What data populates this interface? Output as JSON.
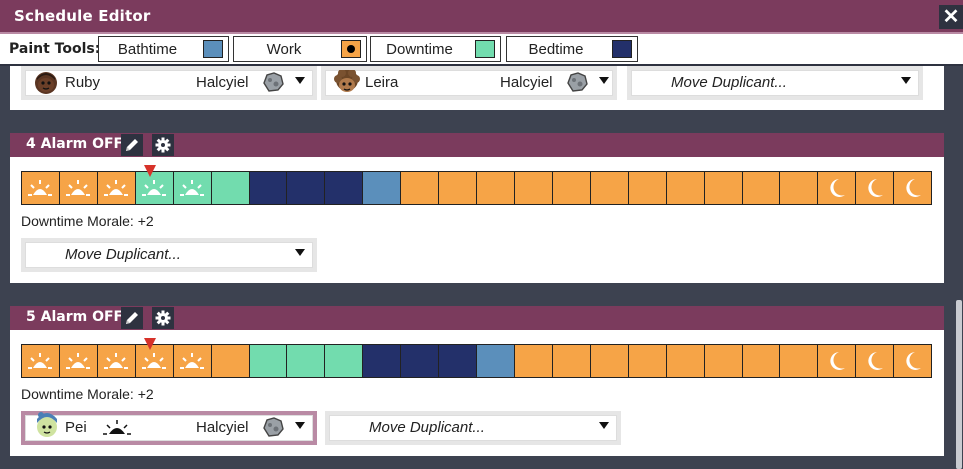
{
  "window": {
    "title": "Schedule Editor",
    "close_glyph": "✕"
  },
  "paint_tools": {
    "label": "Paint Tools:",
    "tools": [
      {
        "label": "Bathtime",
        "color": "#5b8fbb"
      },
      {
        "label": "Work",
        "color": "#f6a447"
      },
      {
        "label": "Downtime",
        "color": "#72dcae"
      },
      {
        "label": "Bedtime",
        "color": "#23306a"
      }
    ]
  },
  "top_row": {
    "duplicants": [
      {
        "name": "Ruby",
        "world": "Halcyiel"
      },
      {
        "name": "Leira",
        "world": "Halcyiel"
      }
    ],
    "move_placeholder": "Move Duplicant..."
  },
  "schedules": [
    {
      "name": "4  Alarm OFF",
      "blocks": [
        "work-sun",
        "work-sun",
        "work-sun",
        "down-sun",
        "down-sun",
        "down",
        "bed",
        "bed",
        "bed",
        "bath",
        "work",
        "work",
        "work",
        "work",
        "work",
        "work",
        "work",
        "work",
        "work",
        "work",
        "work",
        "work-moon",
        "work-moon",
        "work-moon"
      ],
      "current_block": 3,
      "morale": "Downtime Morale: +2",
      "move_placeholder": "Move Duplicant..."
    },
    {
      "name": "5  Alarm OFF",
      "blocks": [
        "work-sun",
        "work-sun",
        "work-sun",
        "work-sun",
        "work-sun",
        "work",
        "down",
        "down",
        "down",
        "bed",
        "bed",
        "bed",
        "bath",
        "work",
        "work",
        "work",
        "work",
        "work",
        "work",
        "work",
        "work",
        "work-moon",
        "work-moon",
        "work-moon"
      ],
      "current_block": 3,
      "morale": "Downtime Morale: +2",
      "duplicant": {
        "name": "Pei",
        "world": "Halcyiel"
      },
      "move_placeholder": "Move Duplicant..."
    }
  ]
}
